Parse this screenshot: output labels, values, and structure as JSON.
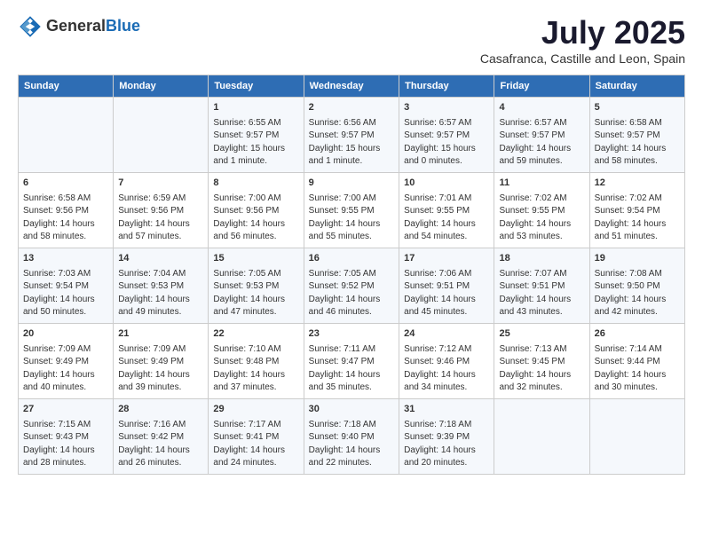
{
  "header": {
    "logo_general": "General",
    "logo_blue": "Blue",
    "month_title": "July 2025",
    "location": "Casafranca, Castille and Leon, Spain"
  },
  "days_of_week": [
    "Sunday",
    "Monday",
    "Tuesday",
    "Wednesday",
    "Thursday",
    "Friday",
    "Saturday"
  ],
  "weeks": [
    [
      {
        "day": "",
        "content": ""
      },
      {
        "day": "",
        "content": ""
      },
      {
        "day": "1",
        "content": "Sunrise: 6:55 AM\nSunset: 9:57 PM\nDaylight: 15 hours and 1 minute."
      },
      {
        "day": "2",
        "content": "Sunrise: 6:56 AM\nSunset: 9:57 PM\nDaylight: 15 hours and 1 minute."
      },
      {
        "day": "3",
        "content": "Sunrise: 6:57 AM\nSunset: 9:57 PM\nDaylight: 15 hours and 0 minutes."
      },
      {
        "day": "4",
        "content": "Sunrise: 6:57 AM\nSunset: 9:57 PM\nDaylight: 14 hours and 59 minutes."
      },
      {
        "day": "5",
        "content": "Sunrise: 6:58 AM\nSunset: 9:57 PM\nDaylight: 14 hours and 58 minutes."
      }
    ],
    [
      {
        "day": "6",
        "content": "Sunrise: 6:58 AM\nSunset: 9:56 PM\nDaylight: 14 hours and 58 minutes."
      },
      {
        "day": "7",
        "content": "Sunrise: 6:59 AM\nSunset: 9:56 PM\nDaylight: 14 hours and 57 minutes."
      },
      {
        "day": "8",
        "content": "Sunrise: 7:00 AM\nSunset: 9:56 PM\nDaylight: 14 hours and 56 minutes."
      },
      {
        "day": "9",
        "content": "Sunrise: 7:00 AM\nSunset: 9:55 PM\nDaylight: 14 hours and 55 minutes."
      },
      {
        "day": "10",
        "content": "Sunrise: 7:01 AM\nSunset: 9:55 PM\nDaylight: 14 hours and 54 minutes."
      },
      {
        "day": "11",
        "content": "Sunrise: 7:02 AM\nSunset: 9:55 PM\nDaylight: 14 hours and 53 minutes."
      },
      {
        "day": "12",
        "content": "Sunrise: 7:02 AM\nSunset: 9:54 PM\nDaylight: 14 hours and 51 minutes."
      }
    ],
    [
      {
        "day": "13",
        "content": "Sunrise: 7:03 AM\nSunset: 9:54 PM\nDaylight: 14 hours and 50 minutes."
      },
      {
        "day": "14",
        "content": "Sunrise: 7:04 AM\nSunset: 9:53 PM\nDaylight: 14 hours and 49 minutes."
      },
      {
        "day": "15",
        "content": "Sunrise: 7:05 AM\nSunset: 9:53 PM\nDaylight: 14 hours and 47 minutes."
      },
      {
        "day": "16",
        "content": "Sunrise: 7:05 AM\nSunset: 9:52 PM\nDaylight: 14 hours and 46 minutes."
      },
      {
        "day": "17",
        "content": "Sunrise: 7:06 AM\nSunset: 9:51 PM\nDaylight: 14 hours and 45 minutes."
      },
      {
        "day": "18",
        "content": "Sunrise: 7:07 AM\nSunset: 9:51 PM\nDaylight: 14 hours and 43 minutes."
      },
      {
        "day": "19",
        "content": "Sunrise: 7:08 AM\nSunset: 9:50 PM\nDaylight: 14 hours and 42 minutes."
      }
    ],
    [
      {
        "day": "20",
        "content": "Sunrise: 7:09 AM\nSunset: 9:49 PM\nDaylight: 14 hours and 40 minutes."
      },
      {
        "day": "21",
        "content": "Sunrise: 7:09 AM\nSunset: 9:49 PM\nDaylight: 14 hours and 39 minutes."
      },
      {
        "day": "22",
        "content": "Sunrise: 7:10 AM\nSunset: 9:48 PM\nDaylight: 14 hours and 37 minutes."
      },
      {
        "day": "23",
        "content": "Sunrise: 7:11 AM\nSunset: 9:47 PM\nDaylight: 14 hours and 35 minutes."
      },
      {
        "day": "24",
        "content": "Sunrise: 7:12 AM\nSunset: 9:46 PM\nDaylight: 14 hours and 34 minutes."
      },
      {
        "day": "25",
        "content": "Sunrise: 7:13 AM\nSunset: 9:45 PM\nDaylight: 14 hours and 32 minutes."
      },
      {
        "day": "26",
        "content": "Sunrise: 7:14 AM\nSunset: 9:44 PM\nDaylight: 14 hours and 30 minutes."
      }
    ],
    [
      {
        "day": "27",
        "content": "Sunrise: 7:15 AM\nSunset: 9:43 PM\nDaylight: 14 hours and 28 minutes."
      },
      {
        "day": "28",
        "content": "Sunrise: 7:16 AM\nSunset: 9:42 PM\nDaylight: 14 hours and 26 minutes."
      },
      {
        "day": "29",
        "content": "Sunrise: 7:17 AM\nSunset: 9:41 PM\nDaylight: 14 hours and 24 minutes."
      },
      {
        "day": "30",
        "content": "Sunrise: 7:18 AM\nSunset: 9:40 PM\nDaylight: 14 hours and 22 minutes."
      },
      {
        "day": "31",
        "content": "Sunrise: 7:18 AM\nSunset: 9:39 PM\nDaylight: 14 hours and 20 minutes."
      },
      {
        "day": "",
        "content": ""
      },
      {
        "day": "",
        "content": ""
      }
    ]
  ]
}
